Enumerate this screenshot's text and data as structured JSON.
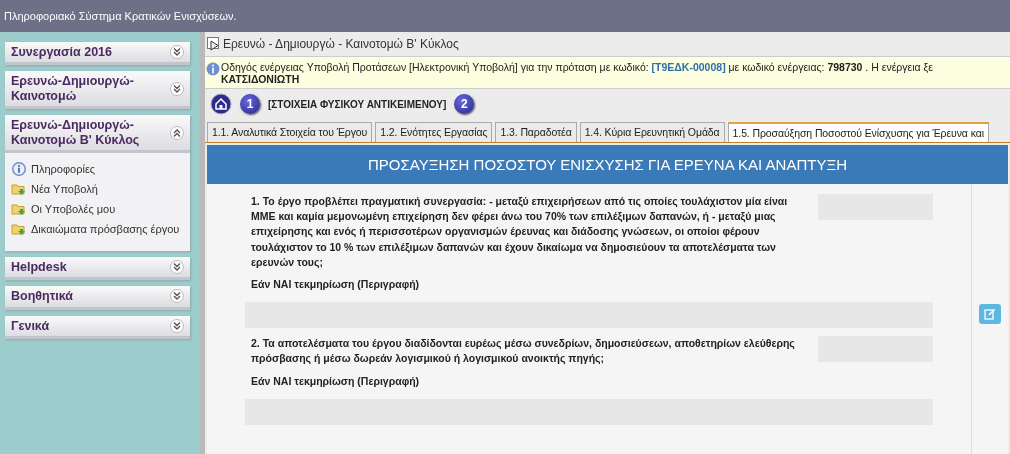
{
  "app_title": "Πληροφοριακό Σύστημα Κρατικών Ενισχύσεων.",
  "sidebar": {
    "sections": [
      {
        "title": "Συνεργασία 2016",
        "expanded": false
      },
      {
        "title": "Ερευνώ-Δημιουργώ-Καινοτομώ",
        "expanded": false
      },
      {
        "title": "Ερευνώ-Δημιουργώ-Καινοτομώ Β' Κύκλος",
        "expanded": true,
        "items": [
          {
            "label": "Πληροφορίες",
            "kind": "info"
          },
          {
            "label": "Νέα Υποβολή",
            "kind": "folder"
          },
          {
            "label": "Οι Υποβολές μου",
            "kind": "folder"
          },
          {
            "label": "Δικαιώματα πρόσβασης έργου",
            "kind": "folder"
          }
        ]
      },
      {
        "title": "Helpdesk",
        "expanded": false
      },
      {
        "title": "Βοηθητικά",
        "expanded": false
      },
      {
        "title": "Γενικά",
        "expanded": false
      }
    ]
  },
  "panel_title": "Ερευνώ - Δημιουργώ - Καινοτομώ Β' Κύκλος",
  "info": {
    "segments": [
      {
        "kind": "plain",
        "text": "Οδηγός ενέργειας Υποβολή Προτάσεων [Ηλεκτρονική Υποβολή] για την πρόταση με κωδικό: "
      },
      {
        "kind": "code",
        "text": "[Τ9ΕΔΚ-00008]"
      },
      {
        "kind": "plain",
        "text": " με κωδικό ενέργειας: "
      },
      {
        "kind": "bold",
        "text": "798730"
      },
      {
        "kind": "plain",
        "text": " . Η ενέργεια ξε"
      }
    ],
    "second_line": "ΚΑΤΣΙΔΟΝΙΩΤΗ"
  },
  "steps": [
    {
      "number": "1",
      "label": "[ΣΤΟΙΧΕΙΑ ΦΥΣΙΚΟΥ ΑΝΤΙΚΕΙΜΕΝΟΥ]"
    },
    {
      "number": "2"
    }
  ],
  "tabs": [
    {
      "label": "1.1. Αναλυτικά Στοιχεία του Έργου",
      "selected": false
    },
    {
      "label": "1.2. Ενότητες Εργασίας",
      "selected": false
    },
    {
      "label": "1.3. Παραδοτέα",
      "selected": false
    },
    {
      "label": "1.4. Κύρια Ερευνητική Ομάδα",
      "selected": false
    },
    {
      "label": "1.5. Προσαύξηση Ποσοστού Ενίσχυσης για Έρευνα και",
      "selected": true
    }
  ],
  "heading": "ΠΡΟΣΑΥΞΗΣΗ ΠΟΣΟΣΤΟΥ ΕΝΙΣΧΥΣΗΣ ΓΙΑ ΕΡΕΥΝΑ ΚΑΙ ΑΝΑΠΤΥΞΗ",
  "questions": [
    {
      "text": "1. Το έργο προβλέπει πραγματική συνεργασία: - μεταξύ επιχειρήσεων από τις οποίες τουλάχιστον μία είναι ΜΜΕ και καμία μεμονωμένη επιχείρηση δεν φέρει άνω του 70% των επιλέξιμων δαπανών, ή - μεταξύ μιας επιχείρησης και ενός ή περισσοτέρων οργανισμών έρευνας και διάδοσης γνώσεων, οι οποίοι φέρουν τουλάχιστον το 10 % των επιλέξιμων δαπανών και έχουν δικαίωμα να δημοσιεύουν τα αποτελέσματα των ερευνών τους;",
      "answer_label": "Εάν ΝΑΙ τεκμηρίωση (Περιγραφή)"
    },
    {
      "text": "2. Τα αποτελέσματα του έργου διαδίδονται ευρέως μέσω συνεδρίων, δημοσιεύσεων, αποθετηρίων ελεύθερης πρόσβασης ή μέσω δωρεάν λογισμικού ή λογισμικού ανοικτής πηγής;",
      "answer_label": "Εάν ΝΑΙ τεκμηρίωση (Περιγραφή)"
    }
  ]
}
